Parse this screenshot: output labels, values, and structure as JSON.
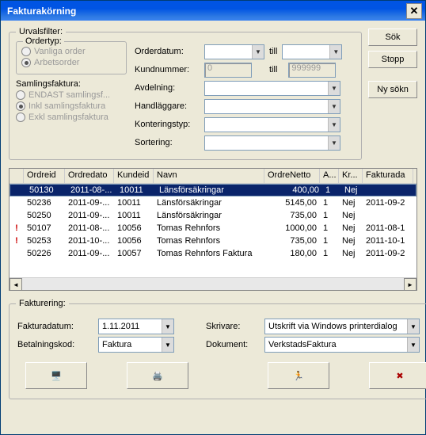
{
  "window": {
    "title": "Fakturakörning"
  },
  "buttons": {
    "search": "Sök",
    "stop": "Stopp",
    "newsearch": "Ny sökn"
  },
  "urvalsfilter": {
    "legend": "Urvalsfilter:",
    "ordertyp": {
      "legend": "Ordertyp:",
      "opt1": "Vanliga order",
      "opt2": "Arbetsorder"
    },
    "samling": {
      "title": "Samlingsfaktura:",
      "opt1": "ENDAST samlingsf...",
      "opt2": "Inkl samlingsfaktura",
      "opt3": "Exkl samlingsfaktura"
    },
    "fields": {
      "orderdatum": "Orderdatum:",
      "till": "till",
      "kundnummer": "Kundnummer:",
      "kund_from": "0",
      "kund_to": "999999",
      "avdelning": "Avdelning:",
      "handlaggare": "Handläggare:",
      "konteringstyp": "Konteringstyp:",
      "sortering": "Sortering:"
    }
  },
  "table": {
    "headers": [
      "Ordreid",
      "Ordredato",
      "Kundeid",
      "Navn",
      "OrdreNetto",
      "A...",
      "Kr...",
      "Fakturada"
    ],
    "rows": [
      {
        "warn": false,
        "sel": true,
        "cells": [
          "50130",
          "2011-08-...",
          "10011",
          "Länsförsäkringar",
          "400,00",
          "1",
          "Nej",
          ""
        ]
      },
      {
        "warn": false,
        "sel": false,
        "cells": [
          "50236",
          "2011-09-...",
          "10011",
          "Länsförsäkringar",
          "5145,00",
          "1",
          "Nej",
          "2011-09-2"
        ]
      },
      {
        "warn": false,
        "sel": false,
        "cells": [
          "50250",
          "2011-09-...",
          "10011",
          "Länsförsäkringar",
          "735,00",
          "1",
          "Nej",
          ""
        ]
      },
      {
        "warn": true,
        "sel": false,
        "cells": [
          "50107",
          "2011-08-...",
          "10056",
          "Tomas Rehnfors",
          "1000,00",
          "1",
          "Nej",
          "2011-08-1"
        ]
      },
      {
        "warn": true,
        "sel": false,
        "cells": [
          "50253",
          "2011-10-...",
          "10056",
          "Tomas Rehnfors",
          "735,00",
          "1",
          "Nej",
          "2011-10-1"
        ]
      },
      {
        "warn": false,
        "sel": false,
        "cells": [
          "50226",
          "2011-09-...",
          "10057",
          "Tomas Rehnfors Faktura",
          "180,00",
          "1",
          "Nej",
          "2011-09-2"
        ]
      }
    ]
  },
  "fakturering": {
    "legend": "Fakturering:",
    "fakturadatum_lbl": "Fakturadatum:",
    "fakturadatum_val": "1.11.2011",
    "betalningskod_lbl": "Betalningskod:",
    "betalningskod_val": "Faktura",
    "skrivare_lbl": "Skrivare:",
    "skrivare_val": "Utskrift via Windows printerdialog",
    "dokument_lbl": "Dokument:",
    "dokument_val": "VerkstadsFaktura"
  },
  "icons": {
    "computer": "🖥️",
    "printer": "🖨️",
    "run": "🏃",
    "cancel": "✖"
  }
}
